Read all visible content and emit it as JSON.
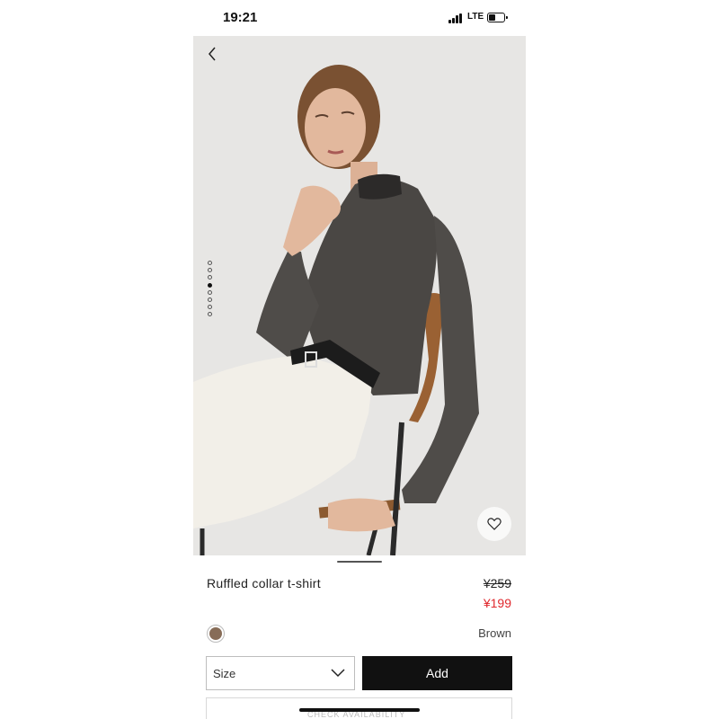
{
  "status_bar": {
    "time": "19:21",
    "network": "LTE"
  },
  "product": {
    "name": "Ruffled collar t-shirt",
    "price_original": "¥259",
    "price_sale": "¥199",
    "color_name": "Brown",
    "color_hex": "#876c57"
  },
  "carousel": {
    "count": 8,
    "active_index": 3
  },
  "actions": {
    "size_placeholder": "Size",
    "add_label": "Add"
  },
  "bottom": {
    "partial_text": "CHECK AVAILABILITY"
  },
  "icons": {
    "back": "chevron-left-icon",
    "wishlist": "heart-icon",
    "size_dropdown": "chevron-down-icon"
  },
  "colors": {
    "accent": "#111111",
    "sale": "#e0282d",
    "photo_bg": "#e7e6e4"
  }
}
